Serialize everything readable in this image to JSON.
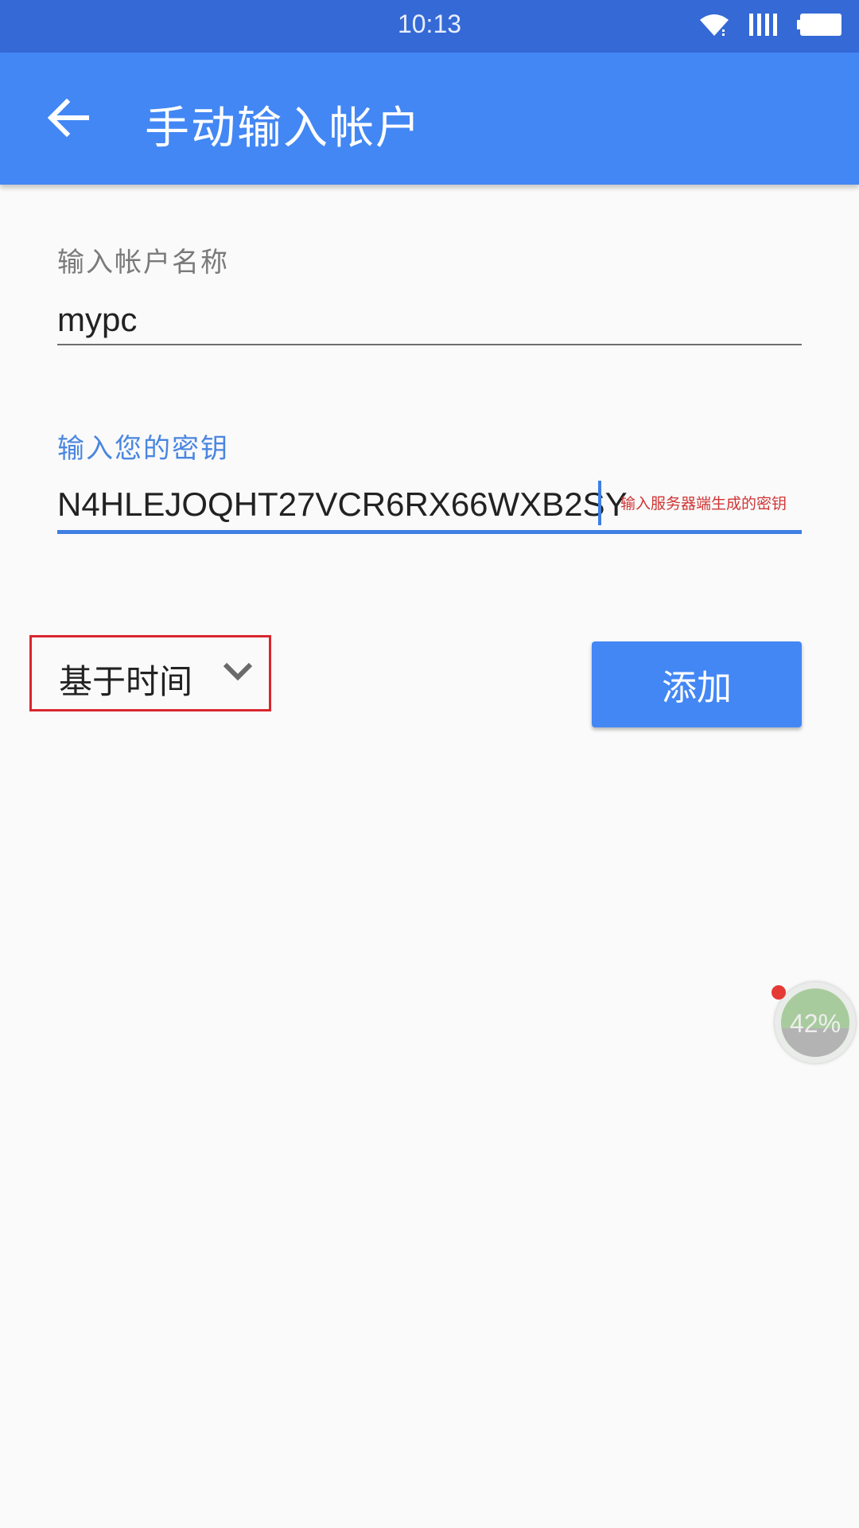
{
  "status_bar": {
    "time": "10:13",
    "icons": [
      "wifi-icon",
      "signal-icon",
      "battery-icon"
    ]
  },
  "app_bar": {
    "title": "手动输入帐户",
    "back_icon": "arrow-back-icon"
  },
  "form": {
    "account_name": {
      "label": "输入帐户名称",
      "value": "mypc"
    },
    "secret_key": {
      "label": "输入您的密钥",
      "value": "N4HLEJOQHT27VCR6RX66WXB2SY",
      "hint": "输入服务器端生成的密钥"
    },
    "key_type": {
      "selected": "基于时间"
    },
    "add_label": "添加"
  },
  "floating_widget": {
    "label": "42%",
    "value": 42
  },
  "colors": {
    "status_bar": "#3469d6",
    "primary": "#4387f4",
    "accent": "#3f7fe3",
    "error": "#d03535",
    "highlight_border": "#d9262e"
  }
}
